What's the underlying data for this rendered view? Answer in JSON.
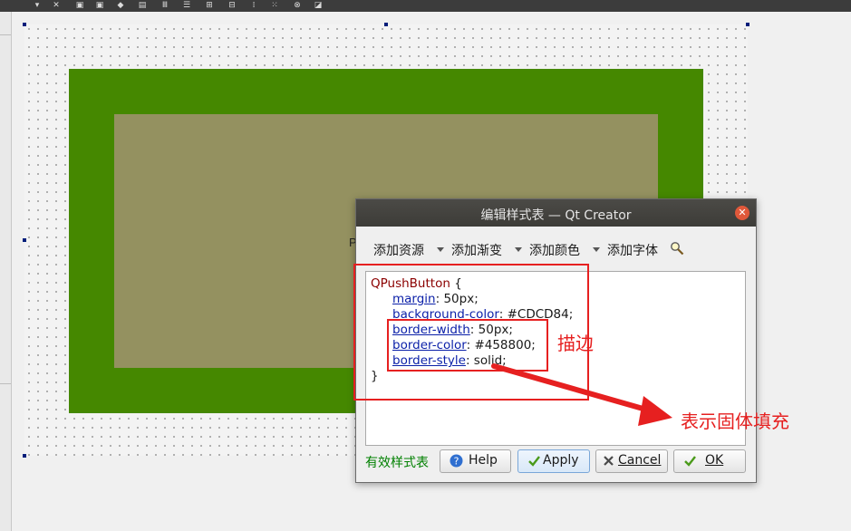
{
  "window": {
    "title": "编辑样式表 — Qt Creator"
  },
  "canvas": {
    "peek_text": "P"
  },
  "dialog": {
    "menu": [
      {
        "label": "添加资源"
      },
      {
        "label": "添加渐变"
      },
      {
        "label": "添加颜色"
      },
      {
        "label": "添加字体"
      }
    ],
    "editor": {
      "selector": "QPushButton",
      "open_brace": "{",
      "close_brace": "}",
      "rules": [
        {
          "prop": "margin",
          "value": "50px;"
        },
        {
          "prop": "background-color",
          "value": "#CDCD84;"
        },
        {
          "prop": "border-width",
          "value": "50px;"
        },
        {
          "prop": "border-color",
          "value": "#458800;"
        },
        {
          "prop": "border-style",
          "value": "solid;"
        }
      ]
    },
    "status": "有效样式表",
    "buttons": {
      "help": "Help",
      "apply": "Apply",
      "cancel": "Cancel",
      "ok": "OK"
    }
  },
  "annotations": {
    "stroke_note": "描边",
    "solid_note": "表示固体填充"
  },
  "colors": {
    "border_green": "#458800",
    "button_fill": "#949160",
    "annotation_red": "#e62020"
  }
}
